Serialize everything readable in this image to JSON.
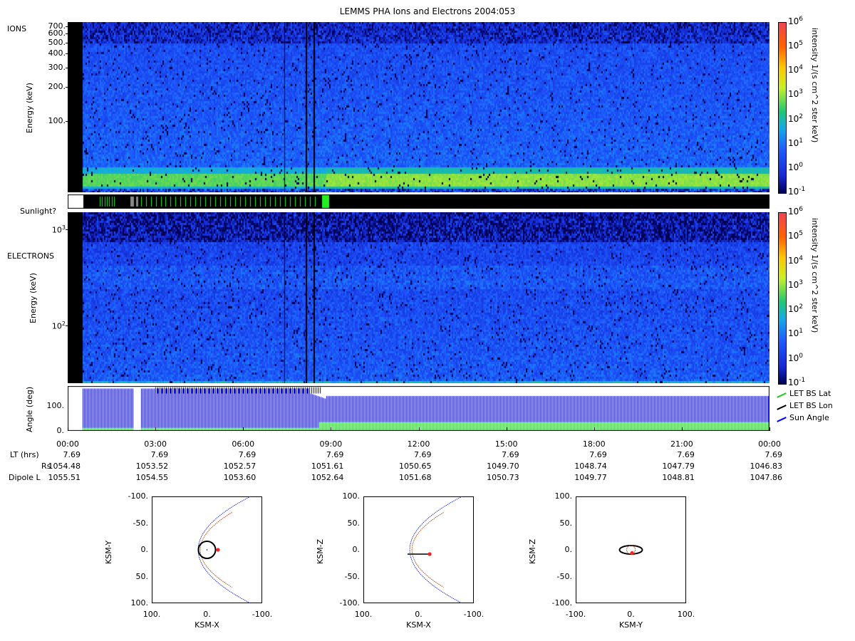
{
  "title": "LEMMS PHA Ions and Electrons  2004:053",
  "chart_data": [
    {
      "type": "heatmap",
      "name": "ions-spectrogram",
      "panel_label": "IONS",
      "ylabel": "Energy (keV)",
      "yscale": "log",
      "ytick_labels": [
        "700.",
        "600.",
        "500.",
        "400.",
        "300.",
        "200.",
        "100."
      ],
      "yticks": [
        700,
        600,
        500,
        400,
        300,
        200,
        100
      ],
      "ylim": [
        23,
        760
      ],
      "xlim_hours": [
        0,
        24
      ],
      "data_gap_hours": [
        0,
        0.5
      ],
      "band_energy_kev": 30,
      "band_level_log10": [
        2.7,
        3.0
      ],
      "colorbar": {
        "label": "intensity 1/(s cm^2 ster keV)",
        "scale": "log",
        "tick_exponents": [
          "6",
          "5",
          "4",
          "3",
          "2",
          "1",
          "0",
          "-1"
        ],
        "range_log10": [
          -1,
          6
        ]
      },
      "grid": false
    },
    {
      "type": "bar",
      "name": "sunlight-strip",
      "label": "Sunlight?",
      "colors": {
        "sunlit": "#22ee22",
        "shadow": "#888888",
        "none": "#000000"
      }
    },
    {
      "type": "heatmap",
      "name": "electrons-spectrogram",
      "panel_label": "ELECTRONS",
      "ylabel": "Energy (keV)",
      "yscale": "log",
      "ytick_labels": [
        "10",
        "10"
      ],
      "ytick_exponents": [
        "3",
        "2"
      ],
      "yticks": [
        1000,
        100
      ],
      "ylim": [
        25,
        1500
      ],
      "xlim_hours": [
        0,
        24
      ],
      "colorbar": {
        "label": "intensity 1/(s cm^2 ster keV)",
        "scale": "log",
        "tick_exponents": [
          "6",
          "5",
          "4",
          "3",
          "2",
          "1",
          "0",
          "-1"
        ],
        "range_log10": [
          -1,
          6
        ]
      },
      "grid": false
    },
    {
      "type": "line",
      "name": "angle-panel",
      "ylabel": "Angle (deg)",
      "ylim": [
        0,
        180
      ],
      "ytick_labels": [
        "100.",
        "0."
      ],
      "yticks": [
        100,
        0
      ],
      "xlim_hours": [
        0,
        24
      ],
      "series": [
        {
          "name": "LET BS Lat",
          "color": "#22cc22",
          "range_deg": [
            0,
            40
          ]
        },
        {
          "name": "LET BS Lon",
          "color": "#000000",
          "range_deg": [
            0,
            175
          ]
        },
        {
          "name": "Sun Angle",
          "color": "#0000ff",
          "range_deg": [
            5,
            170
          ]
        }
      ],
      "legend": "right",
      "x_tick_labels": [
        "00:00",
        "03:00",
        "06:00",
        "09:00",
        "12:00",
        "15:00",
        "18:00",
        "21:00",
        "00:00"
      ]
    },
    {
      "type": "scatter",
      "name": "orbit-xy",
      "xlabel": "KSM-X",
      "ylabel": "KSM-Y",
      "xlim": [
        100,
        -100
      ],
      "ylim": [
        -100,
        100
      ],
      "x_tick_labels": [
        "100.",
        "0.",
        "-100."
      ],
      "y_tick_labels": [
        "-100.",
        "-50.",
        "0.",
        "50.",
        "100."
      ],
      "spacecraft_position": [
        -20,
        0
      ]
    },
    {
      "type": "scatter",
      "name": "orbit-xz",
      "xlabel": "KSM-X",
      "ylabel": "KSM-Z",
      "xlim": [
        100,
        -100
      ],
      "ylim": [
        100,
        -100
      ],
      "x_tick_labels": [
        "100.",
        "0.",
        "-100."
      ],
      "y_tick_labels": [
        "100.",
        "50.",
        "0.",
        "-50.",
        "-100."
      ],
      "spacecraft_position": [
        -20,
        -8
      ]
    },
    {
      "type": "scatter",
      "name": "orbit-yz",
      "xlabel": "KSM-Y",
      "ylabel": "KSM-Z",
      "xlim": [
        -100,
        100
      ],
      "ylim": [
        100,
        -100
      ],
      "x_tick_labels": [
        "-100.",
        "0.",
        "100."
      ],
      "y_tick_labels": [
        "100.",
        "50.",
        "0.",
        "-50.",
        "-100."
      ],
      "spacecraft_position": [
        2,
        -6
      ]
    }
  ],
  "ephemeris": {
    "rows": [
      {
        "label": "LT (hrs)",
        "values": [
          "7.69",
          "7.69",
          "7.69",
          "7.69",
          "7.69",
          "7.69",
          "7.69",
          "7.69",
          "7.69"
        ]
      },
      {
        "label": "Rs",
        "values": [
          "1054.48",
          "1053.52",
          "1052.57",
          "1051.61",
          "1050.65",
          "1049.70",
          "1048.74",
          "1047.79",
          "1046.83"
        ]
      },
      {
        "label": "Dipole L",
        "values": [
          "1055.51",
          "1054.55",
          "1053.60",
          "1052.64",
          "1051.68",
          "1050.73",
          "1049.77",
          "1048.81",
          "1047.86"
        ]
      }
    ]
  },
  "colors": {
    "spectro_low": "#1a2fd6",
    "spectro_band": "#e8f020",
    "magnetopause": "#b0501e",
    "bow_shock": "#2030e0",
    "spacecraft": "#ff2020"
  }
}
